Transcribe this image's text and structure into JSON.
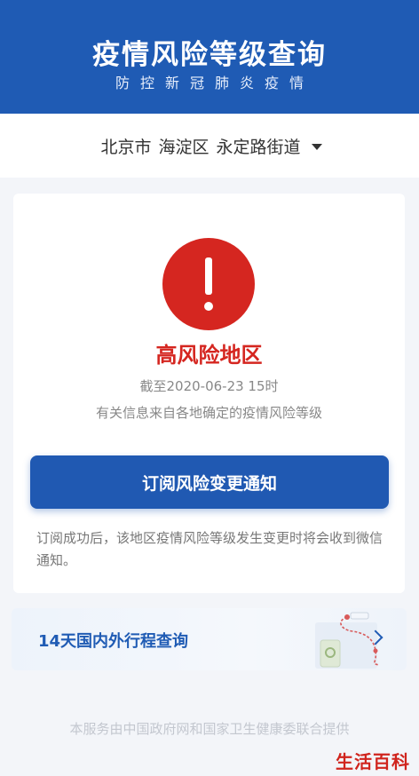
{
  "header": {
    "title": "疫情风险等级查询",
    "subtitle": "防控新冠肺炎疫情"
  },
  "location": {
    "city": "北京市",
    "district": "海淀区",
    "street": "永定路街道"
  },
  "risk": {
    "level_label": "高风险地区",
    "as_of": "截至2020-06-23 15时",
    "source_note": "有关信息来自各地确定的疫情风险等级",
    "level_color": "#d52620"
  },
  "subscribe": {
    "button_label": "订阅风险变更通知",
    "note": "订阅成功后，该地区疫情风险等级发生变更时将会收到微信通知。"
  },
  "trip": {
    "label": "14天国内外行程查询"
  },
  "footer": {
    "text": "本服务由中国政府网和国家卫生健康委联合提供"
  },
  "watermark": {
    "text": "生活百科"
  },
  "colors": {
    "brand": "#1f5bb4",
    "danger": "#d52620",
    "background": "#f3f5f9"
  }
}
